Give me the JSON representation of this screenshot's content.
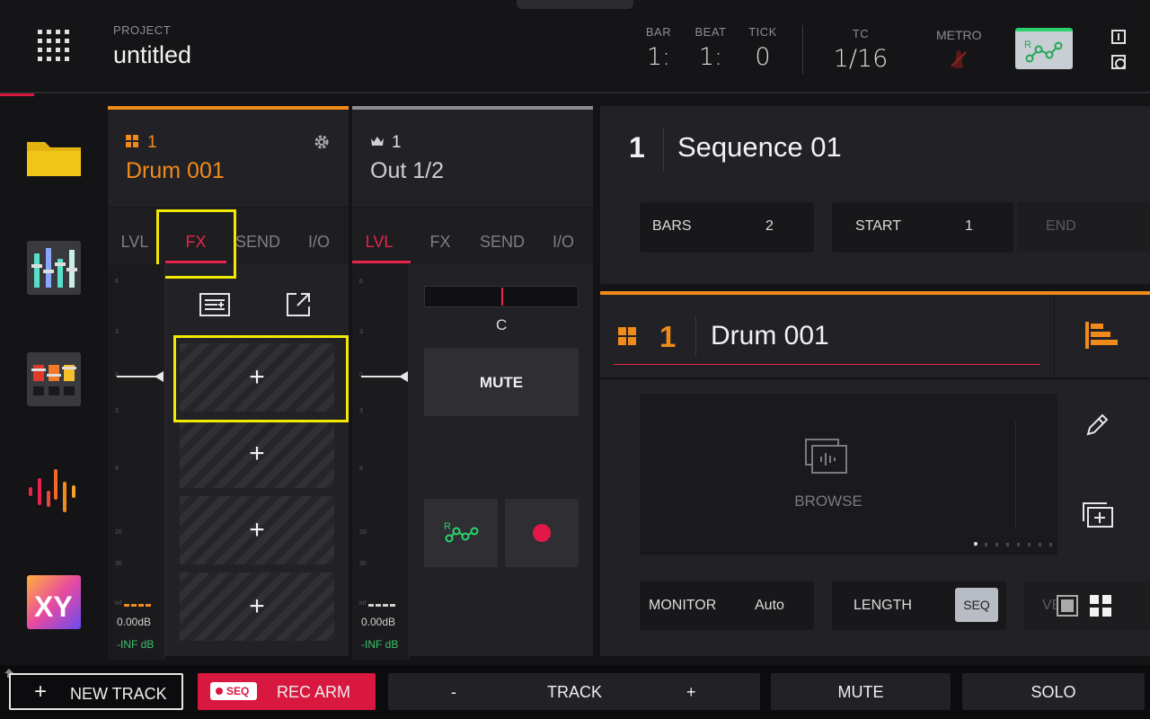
{
  "header": {
    "project_label": "PROJECT",
    "project_name": "untitled",
    "bar_label": "BAR",
    "bar_value": "1:",
    "beat_label": "BEAT",
    "beat_value": "1:",
    "tick_label": "TICK",
    "tick_value": "0",
    "tc_label": "TC",
    "tc_value": "1/16",
    "metro_label": "METRO",
    "automation_letter": "R"
  },
  "sidebar": {
    "items": [
      "folder-icon",
      "mixer-icon",
      "channel-mixer-icon",
      "sample-edit-icon",
      "xyfx-icon"
    ],
    "xy_text": "XY"
  },
  "strip1": {
    "number": "1",
    "name": "Drum 001",
    "tabs": [
      "LVL",
      "FX",
      "SEND",
      "I/O"
    ],
    "active_tab": "FX",
    "meter_ticks": [
      "6",
      "3",
      "0",
      "3",
      "9",
      "20",
      "30",
      "inf"
    ],
    "db_value": "0.00dB",
    "inf_value": "-INF dB",
    "fx_slot_label": "+"
  },
  "strip2": {
    "number": "1",
    "name": "Out 1/2",
    "tabs": [
      "LVL",
      "FX",
      "SEND",
      "I/O"
    ],
    "active_tab": "LVL",
    "meter_ticks": [
      "6",
      "3",
      "0",
      "3",
      "9",
      "20",
      "30",
      "inf"
    ],
    "db_value": "0.00dB",
    "inf_value": "-INF dB",
    "pan_label": "C",
    "mute_label": "MUTE",
    "automation_letter": "R"
  },
  "sequence": {
    "number": "1",
    "name": "Sequence 01",
    "bars_label": "BARS",
    "bars_value": "2",
    "start_label": "START",
    "start_value": "1",
    "end_label": "END"
  },
  "track": {
    "number": "1",
    "name": "Drum 001",
    "browse_label": "BROWSE",
    "monitor_label": "MONITOR",
    "monitor_value": "Auto",
    "length_label": "LENGTH",
    "length_value": "SEQ",
    "velocity_label": "VEL"
  },
  "bottom_bar": {
    "new_track": "NEW TRACK",
    "rec_arm_badge": "SEQ",
    "rec_arm": "REC ARM",
    "track_minus": "-",
    "track": "TRACK",
    "track_plus": "+",
    "mute": "MUTE",
    "solo": "SOLO"
  },
  "colors": {
    "accent_red": "#e8244a",
    "accent_orange": "#f08a1a",
    "automation_green": "#2bd46b",
    "highlight_yellow": "#f2e800"
  }
}
